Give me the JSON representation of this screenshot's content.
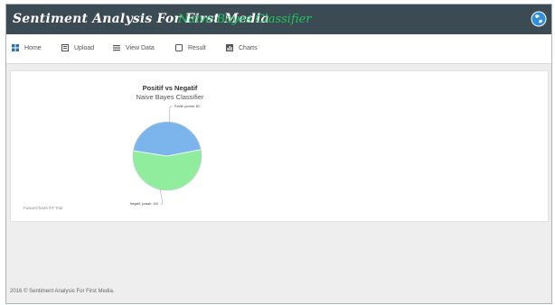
{
  "header": {
    "brand": "Sentiment Analysis For First Media",
    "subtitle": "Naive Bayes Classifier",
    "profile_icon": "globe-icon"
  },
  "menu": [
    {
      "label": "Home",
      "icon": "home-icon"
    },
    {
      "label": "Upload",
      "icon": "upload-icon"
    },
    {
      "label": "View Data",
      "icon": "list-icon"
    },
    {
      "label": "Result",
      "icon": "result-icon"
    },
    {
      "label": "Charts",
      "icon": "chart-icon"
    }
  ],
  "chart_data": {
    "type": "pie",
    "title": "Positif vs Negatif",
    "subtitle": "Naive Bayes Classifier",
    "slices": [
      {
        "label": "Positif, jumlah: 80",
        "name": "Positif",
        "value": 80,
        "color": "#7cb5ec"
      },
      {
        "label": "Negatif, jumlah: 100",
        "name": "Negatif",
        "value": 100,
        "color": "#90ed9d"
      }
    ]
  },
  "watermark": "FusionCharts XT Trial",
  "footer": "2016 © Sentiment Analysis For First Media."
}
